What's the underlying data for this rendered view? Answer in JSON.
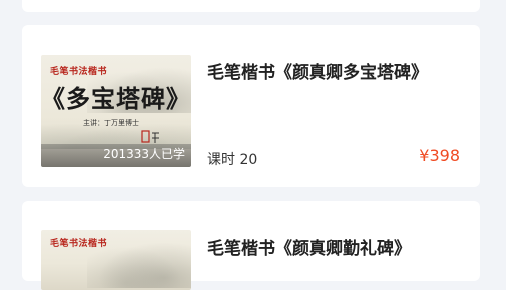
{
  "courses": [
    {
      "title": "毛笔楷书《颜真卿多宝塔碑》",
      "cover_tag": "毛笔书法楷书",
      "cover_title": "《多宝塔碑》",
      "cover_speaker": "主讲：丁万里博士",
      "learners": "201333人已学",
      "lessons": "课时 20",
      "price": "¥398"
    },
    {
      "title": "毛笔楷书《颜真卿勤礼碑》",
      "cover_tag": "毛笔书法楷书"
    }
  ],
  "colors": {
    "page_background": "#f2f4f8",
    "card_background": "#ffffff",
    "price": "#f04b23",
    "cover_tag": "#b8261d"
  }
}
